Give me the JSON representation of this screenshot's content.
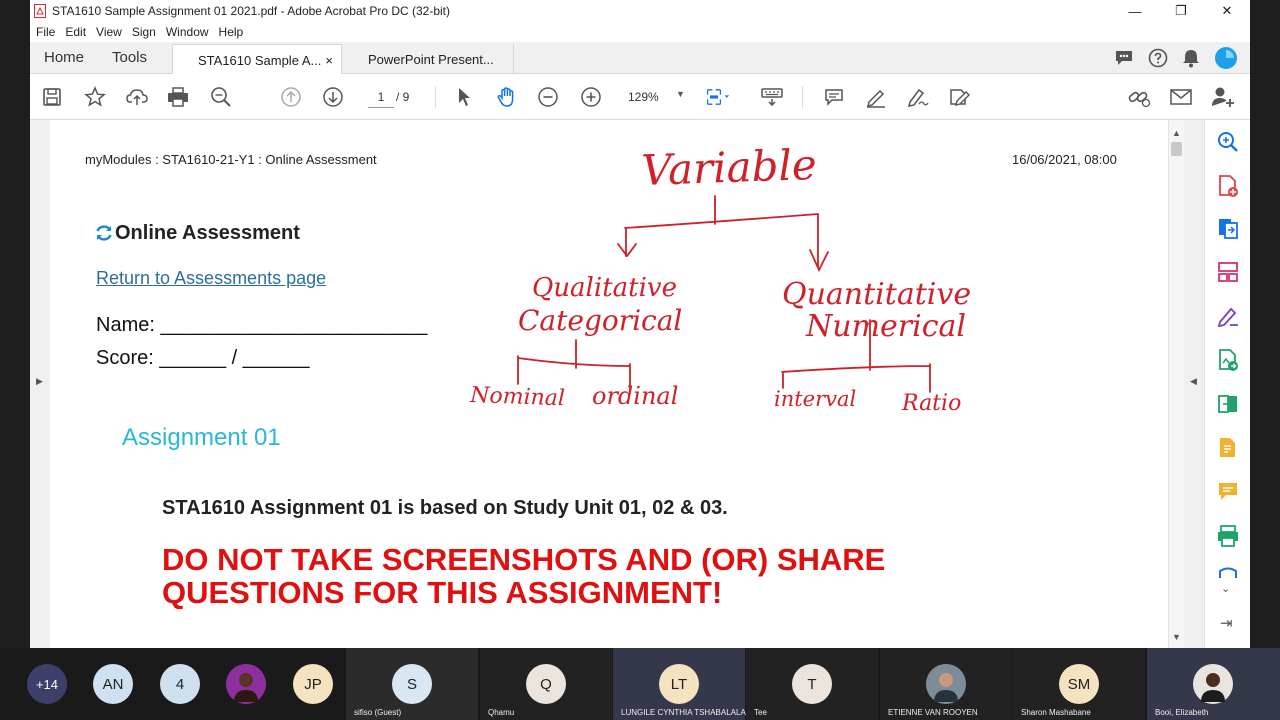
{
  "window": {
    "title": "STA1610 Sample Assignment 01 2021.pdf - Adobe Acrobat Pro DC (32-bit)",
    "minimize": "—",
    "maximize": "❐",
    "close": "✕"
  },
  "menu": [
    "File",
    "Edit",
    "View",
    "Sign",
    "Window",
    "Help"
  ],
  "tabs": {
    "home": "Home",
    "tools": "Tools",
    "doc1": "STA1610 Sample A...",
    "doc1_close": "×",
    "doc2": "PowerPoint Present..."
  },
  "toolbar": {
    "page_current": "1",
    "page_total": "/ 9",
    "zoom": "129%"
  },
  "document": {
    "header_left": "myModules : STA1610-21-Y1 : Online Assessment",
    "header_right": "16/06/2021, 08:00",
    "title": "Online Assessment",
    "return_link": "Return to Assessments page",
    "name_label": "Name: ________________________",
    "score_label": "Score: ______ / ______",
    "assignment_heading": "Assignment 01",
    "based_on": "STA1610 Assignment 01 is based on Study Unit 01, 02 & 03.",
    "warning_line1": "DO NOT TAKE SCREENSHOTS AND (OR) SHARE",
    "warning_line2": "QUESTIONS FOR THIS ASSIGNMENT!"
  },
  "annotation": {
    "variable": "Variable",
    "qualitative": "Qualitative",
    "categorical": "Categorical",
    "quantitative": "Quantitative",
    "numerical": "Numerical",
    "nominal": "Nominal",
    "ordinal": "ordinal",
    "interval": "interval",
    "ratio": "Ratio",
    "ink_color": "#d0202a"
  },
  "participants": {
    "overflow": "+14",
    "bubbles": [
      {
        "initials": "AN",
        "color": "#cfe0f0"
      },
      {
        "initials": "4",
        "color": "#cfe0f0"
      },
      {
        "initials": "JP",
        "color": "#f5e2c0"
      }
    ],
    "tiles": [
      {
        "initials": "S",
        "name": "sifiso (Guest)",
        "color": "#d8e8f2"
      },
      {
        "initials": "Q",
        "name": "Qhamu",
        "color": "#ece4dc"
      },
      {
        "initials": "LT",
        "name": "LUNGILE CYNTHIA TSHABALALA",
        "color": "#f5e2c0"
      },
      {
        "initials": "T",
        "name": "Tee",
        "color": "#ece4dc"
      },
      {
        "initials": "",
        "name": "ETIENNE VAN ROOYEN",
        "color": "#6b7b8a"
      },
      {
        "initials": "SM",
        "name": "Sharon Mashabane",
        "color": "#f5e2c0"
      },
      {
        "initials": "",
        "name": "Booi, Elizabeth",
        "color": "#5a4a3e"
      }
    ]
  }
}
